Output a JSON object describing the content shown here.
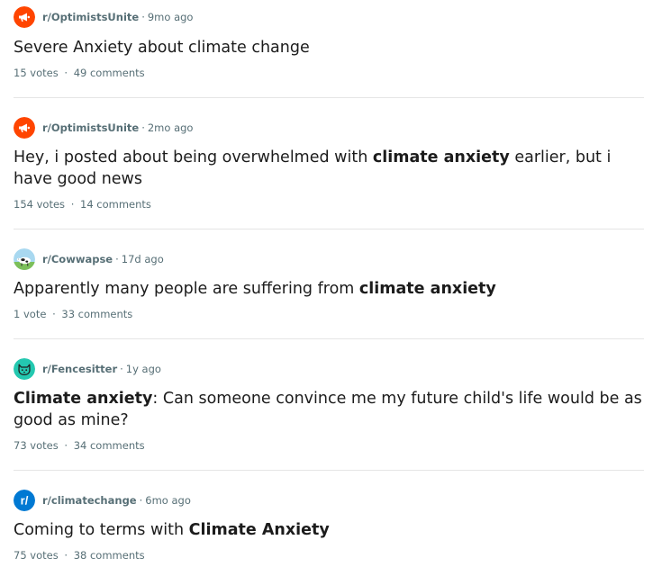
{
  "posts": [
    {
      "subreddit": "r/OptimistsUnite",
      "age": "9mo ago",
      "title_parts": [
        {
          "text": "Severe Anxiety about climate change",
          "bold": false
        }
      ],
      "votes": "15 votes",
      "comments": "49 comments",
      "avatar_icon": "megaphone-icon",
      "avatar_color": "#ff4500"
    },
    {
      "subreddit": "r/OptimistsUnite",
      "age": "2mo ago",
      "title_parts": [
        {
          "text": "Hey, i posted about being overwhelmed with ",
          "bold": false
        },
        {
          "text": "climate anxiety",
          "bold": true
        },
        {
          "text": " earlier, but i have good news",
          "bold": false
        }
      ],
      "votes": "154 votes",
      "comments": "14 comments",
      "avatar_icon": "megaphone-icon",
      "avatar_color": "#ff4500"
    },
    {
      "subreddit": "r/Cowwapse",
      "age": "17d ago",
      "title_parts": [
        {
          "text": "Apparently many people are suffering from ",
          "bold": false
        },
        {
          "text": "climate anxiety",
          "bold": true
        }
      ],
      "votes": "1 vote",
      "comments": "33 comments",
      "avatar_icon": "cow-icon",
      "avatar_color": "#a8d8f0"
    },
    {
      "subreddit": "r/Fencesitter",
      "age": "1y ago",
      "title_parts": [
        {
          "text": "Climate anxiety",
          "bold": true
        },
        {
          "text": ": Can someone convince me my future child's life would be as good as mine?",
          "bold": false
        }
      ],
      "votes": "73 votes",
      "comments": "34 comments",
      "avatar_icon": "cat-icon",
      "avatar_color": "#24c8b0"
    },
    {
      "subreddit": "r/climatechange",
      "age": "6mo ago",
      "title_parts": [
        {
          "text": "Coming to terms with ",
          "bold": false
        },
        {
          "text": "Climate Anxiety",
          "bold": true
        }
      ],
      "votes": "75 votes",
      "comments": "38 comments",
      "avatar_icon": "reddit-r-icon",
      "avatar_color": "#0079d3"
    }
  ],
  "separator": "·"
}
